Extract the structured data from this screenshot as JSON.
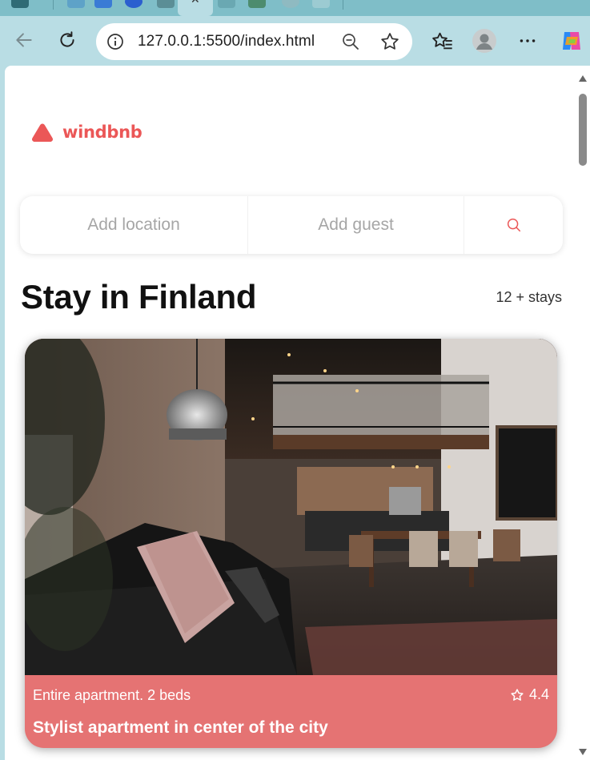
{
  "browser": {
    "url": "127.0.0.1:5500/index.html",
    "theme_color": "#b9dde4"
  },
  "app": {
    "brand": "windbnb",
    "brand_color": "#eb5757",
    "search": {
      "location_placeholder": "Add location",
      "guest_placeholder": "Add guest"
    },
    "heading": "Stay in Finland",
    "stays_count": "12 + stays",
    "stays": [
      {
        "type": "Entire apartment. 2 beds",
        "rating": "4.4",
        "title": "Stylist apartment in center of the city",
        "card_color": "#e57373"
      }
    ]
  }
}
